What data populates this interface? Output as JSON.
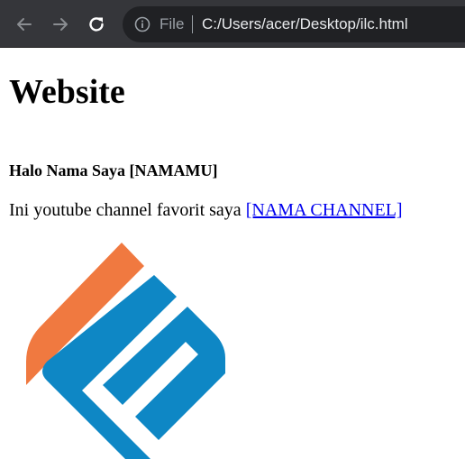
{
  "browser": {
    "back_icon": "arrow-left-icon",
    "forward_icon": "arrow-right-icon",
    "reload_icon": "reload-icon",
    "info_icon": "info-circle-icon",
    "scheme_label": "File",
    "url": "C:/Users/acer/Desktop/ilc.html"
  },
  "page": {
    "heading": "Website",
    "greeting": "Halo Nama Saya [NAMAMU]",
    "channel_text": "Ini youtube channel favorit saya ",
    "channel_link": "[NAMA CHANNEL]",
    "logo": {
      "name": "ilc-logo",
      "colors": {
        "orange": "#f07940",
        "blue": "#0e87c5"
      }
    }
  }
}
